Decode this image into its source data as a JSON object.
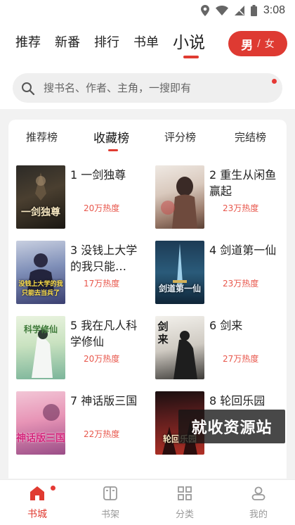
{
  "status_bar": {
    "time": "3:08",
    "icons": [
      "location-icon",
      "wifi-icon",
      "signal-icon",
      "battery-icon"
    ]
  },
  "header": {
    "tabs": [
      {
        "label": "推荐",
        "active": false
      },
      {
        "label": "新番",
        "active": false
      },
      {
        "label": "排行",
        "active": false
      },
      {
        "label": "书单",
        "active": false
      },
      {
        "label": "小说",
        "active": true
      }
    ],
    "gender_toggle": {
      "male": "男",
      "separator": "/",
      "female": "女",
      "selected": "男"
    },
    "search": {
      "placeholder": "搜书名、作者、主角，一搜即有"
    }
  },
  "ranking": {
    "tabs": [
      {
        "label": "推荐榜",
        "active": false
      },
      {
        "label": "收藏榜",
        "active": true
      },
      {
        "label": "评分榜",
        "active": false
      },
      {
        "label": "完结榜",
        "active": false
      }
    ],
    "books": [
      {
        "rank": "1",
        "title": "1 一剑独尊",
        "heat": "20万热度",
        "cover_text": "一剑独尊"
      },
      {
        "rank": "2",
        "title": "2 重生从闲鱼赢起",
        "heat": "23万热度",
        "cover_text": ""
      },
      {
        "rank": "3",
        "title": "3 没钱上大学的我只能…",
        "heat": "17万热度",
        "cover_text": "没钱上大学的我只能去当兵了"
      },
      {
        "rank": "4",
        "title": "4 剑道第一仙",
        "heat": "23万热度",
        "cover_text": "剑道第一仙"
      },
      {
        "rank": "5",
        "title": "5 我在凡人科学修仙",
        "heat": "20万热度",
        "cover_text": "科学修仙"
      },
      {
        "rank": "6",
        "title": "6 剑来",
        "heat": "27万热度",
        "cover_text": "剑来"
      },
      {
        "rank": "7",
        "title": "7 神话版三国",
        "heat": "22万热度",
        "cover_text": "神话版三国"
      },
      {
        "rank": "8",
        "title": "8 轮回乐园",
        "heat": "",
        "cover_text": "轮回乐园"
      }
    ]
  },
  "watermark": "就收资源站",
  "bottom_nav": [
    {
      "label": "书城",
      "icon": "home-icon",
      "active": true
    },
    {
      "label": "书架",
      "icon": "bookshelf-icon",
      "active": false
    },
    {
      "label": "分类",
      "icon": "category-icon",
      "active": false
    },
    {
      "label": "我的",
      "icon": "profile-icon",
      "active": false
    }
  ],
  "colors": {
    "accent": "#de3a32",
    "heat": "#e8574c",
    "background": "#f2f2f2"
  }
}
